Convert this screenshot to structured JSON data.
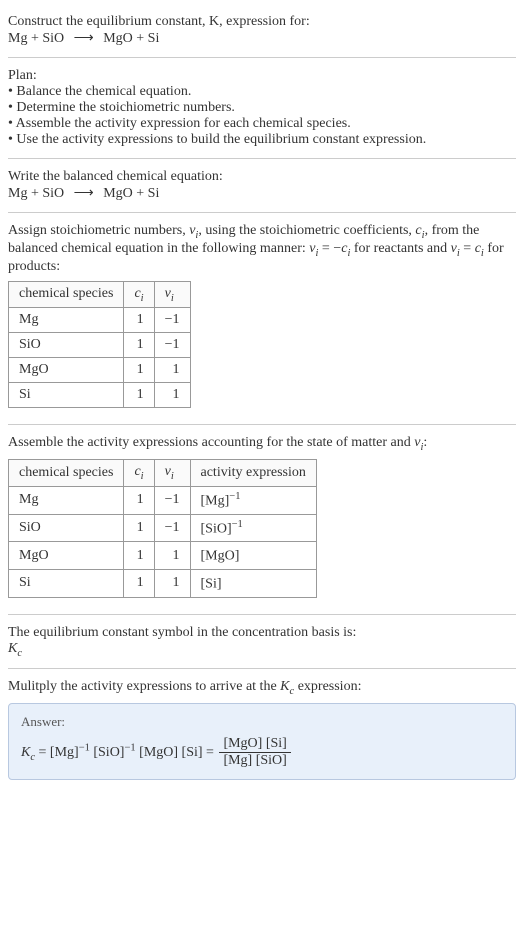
{
  "prompt": {
    "line1": "Construct the equilibrium constant, K, expression for:",
    "eq_left": "Mg + SiO",
    "eq_right": "MgO + Si"
  },
  "plan": {
    "header": "Plan:",
    "b1": "• Balance the chemical equation.",
    "b2": "• Determine the stoichiometric numbers.",
    "b3": "• Assemble the activity expression for each chemical species.",
    "b4": "• Use the activity expressions to build the equilibrium constant expression."
  },
  "balanced": {
    "line": "Write the balanced chemical equation:",
    "eq_left": "Mg + SiO",
    "eq_right": "MgO + Si"
  },
  "stoich": {
    "intro_a": "Assign stoichiometric numbers, ",
    "nu": "ν",
    "sub_i": "i",
    "intro_b": ", using the stoichiometric coefficients, ",
    "c": "c",
    "intro_c": ", from the balanced chemical equation in the following manner: ",
    "rel1": " = −",
    "intro_d": " for reactants and ",
    "rel2": " = ",
    "intro_e": " for products:"
  },
  "table1": {
    "h1": "chemical species",
    "h2": "cᵢ",
    "h3": "νᵢ",
    "rows": [
      {
        "sp": "Mg",
        "c": "1",
        "v": "−1"
      },
      {
        "sp": "SiO",
        "c": "1",
        "v": "−1"
      },
      {
        "sp": "MgO",
        "c": "1",
        "v": "1"
      },
      {
        "sp": "Si",
        "c": "1",
        "v": "1"
      }
    ]
  },
  "assemble": {
    "line_a": "Assemble the activity expressions accounting for the state of matter and ",
    "line_b": ":"
  },
  "table2": {
    "h1": "chemical species",
    "h2": "cᵢ",
    "h3": "νᵢ",
    "h4": "activity expression",
    "rows": [
      {
        "sp": "Mg",
        "c": "1",
        "v": "−1",
        "a_open": "[Mg]",
        "a_exp": "−1"
      },
      {
        "sp": "SiO",
        "c": "1",
        "v": "−1",
        "a_open": "[SiO]",
        "a_exp": "−1"
      },
      {
        "sp": "MgO",
        "c": "1",
        "v": "1",
        "a_open": "[MgO]",
        "a_exp": ""
      },
      {
        "sp": "Si",
        "c": "1",
        "v": "1",
        "a_open": "[Si]",
        "a_exp": ""
      }
    ]
  },
  "symbol": {
    "line": "The equilibrium constant symbol in the concentration basis is:",
    "K": "K",
    "sub_c": "c"
  },
  "mult": {
    "line_a": "Mulitply the activity expressions to arrive at the ",
    "line_b": " expression:"
  },
  "answer": {
    "label": "Answer:",
    "eq1": " = [Mg]",
    "neg1a": "−1",
    "eq2": " [SiO]",
    "neg1b": "−1",
    "eq3": " [MgO] [Si] = ",
    "frac_top": "[MgO] [Si]",
    "frac_bot": "[Mg] [SiO]"
  },
  "arrow": "⟶"
}
